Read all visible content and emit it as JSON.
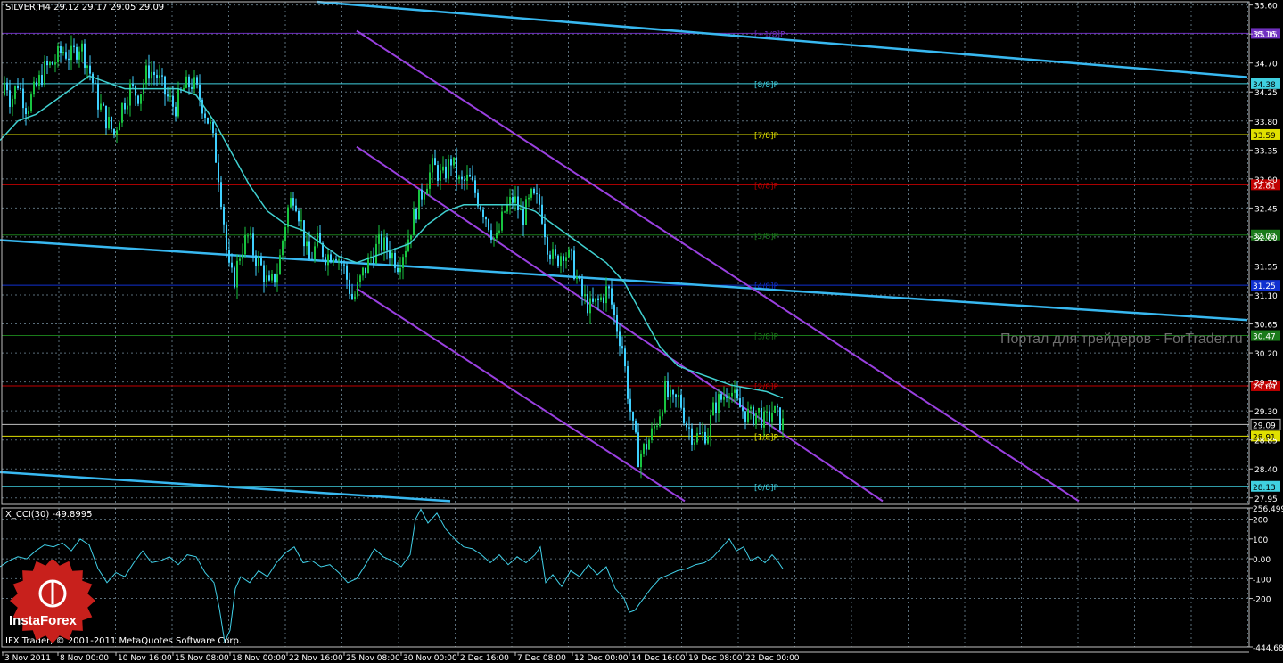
{
  "window": {
    "symbol_header": "SILVER,H4  29.12 29.17 29.05 29.09",
    "indicator_header": "X_CCI(30) -49.8995",
    "copyright": "IFX Trader, © 2001-2011 MetaQuotes Software Corp.",
    "watermark": "Портал для трейдеров - ForTrader.ru",
    "logo_text": "InstaForex"
  },
  "colors": {
    "background": "#000000",
    "grid": "#5a6e7a",
    "frame": "#c0c0c0",
    "bull_candle": "#18c440",
    "bear_candle": "#3fd0ff",
    "ma_line": "#40d0d0",
    "trend_line": "#38b8f0",
    "channel_line": "#9a40e0",
    "cci_line": "#40d0e8",
    "logo_red": "#c8201c"
  },
  "chart_data": {
    "type": "candlestick",
    "price_axis": {
      "ticks": [
        "35.60",
        "35.15",
        "34.70",
        "34.25",
        "33.80",
        "33.35",
        "32.90",
        "32.45",
        "32.00",
        "31.55",
        "31.10",
        "30.65",
        "30.20",
        "29.75",
        "29.30",
        "28.85",
        "28.40",
        "27.95"
      ],
      "range": [
        27.85,
        35.65
      ]
    },
    "time_axis": {
      "labels": [
        "3 Nov 2011",
        "8 Nov 00:00",
        "10 Nov 16:00",
        "15 Nov 08:00",
        "18 Nov 00:00",
        "22 Nov 16:00",
        "25 Nov 08:00",
        "30 Nov 00:00",
        "2 Dec 16:00",
        "7 Dec 08:00",
        "12 Dec 00:00",
        "14 Dec 16:00",
        "19 Dec 08:00",
        "22 Dec 00:00"
      ]
    },
    "murrey_levels": [
      {
        "name": "[+1/8]P",
        "value": 35.16,
        "tag": "35.16",
        "color": "#7030c0"
      },
      {
        "name": "[8/8]P",
        "value": 34.38,
        "tag": "34.38",
        "color": "#40d0e0"
      },
      {
        "name": "[7/8]P",
        "value": 33.59,
        "tag": "33.59",
        "color": "#e0e000"
      },
      {
        "name": "[6/8]P",
        "value": 32.81,
        "tag": "32.81",
        "color": "#c00000"
      },
      {
        "name": "[5/8]P",
        "value": 32.03,
        "tag": "32.03",
        "color": "#1a7a1a"
      },
      {
        "name": "[4/8]P",
        "value": 31.25,
        "tag": "31.25",
        "color": "#1030d0"
      },
      {
        "name": "[3/8]P",
        "value": 30.47,
        "tag": "30.47",
        "color": "#1a7a1a"
      },
      {
        "name": "[2/8]P",
        "value": 29.69,
        "tag": "29.69",
        "color": "#c00000"
      },
      {
        "name": "[1/8]P",
        "value": 28.91,
        "tag": "28.91",
        "color": "#e0e000"
      },
      {
        "name": "[0/8]P",
        "value": 28.13,
        "tag": "28.13",
        "color": "#40d0e0"
      }
    ],
    "current_price": {
      "value": 29.09,
      "tag": "29.09"
    },
    "ohlc_path": [
      [
        0,
        33.9
      ],
      [
        6,
        34.5
      ],
      [
        12,
        34.1
      ],
      [
        20,
        34.4
      ],
      [
        30,
        34.0
      ],
      [
        40,
        34.3
      ],
      [
        50,
        34.6
      ],
      [
        60,
        34.7
      ],
      [
        70,
        34.9
      ],
      [
        80,
        34.8
      ],
      [
        90,
        35.0
      ],
      [
        100,
        34.6
      ],
      [
        110,
        34.1
      ],
      [
        120,
        33.8
      ],
      [
        128,
        33.6
      ],
      [
        136,
        34.0
      ],
      [
        146,
        34.3
      ],
      [
        156,
        34.2
      ],
      [
        166,
        34.6
      ],
      [
        176,
        34.5
      ],
      [
        186,
        34.2
      ],
      [
        196,
        34.0
      ],
      [
        206,
        34.3
      ],
      [
        216,
        34.4
      ],
      [
        226,
        34.1
      ],
      [
        236,
        33.7
      ],
      [
        244,
        33.1
      ],
      [
        250,
        32.4
      ],
      [
        256,
        31.5
      ],
      [
        262,
        31.3
      ],
      [
        270,
        31.8
      ],
      [
        278,
        32.0
      ],
      [
        286,
        31.7
      ],
      [
        294,
        31.5
      ],
      [
        302,
        31.2
      ],
      [
        312,
        31.5
      ],
      [
        322,
        32.4
      ],
      [
        330,
        32.7
      ],
      [
        338,
        32.2
      ],
      [
        346,
        31.6
      ],
      [
        356,
        31.9
      ],
      [
        366,
        31.7
      ],
      [
        376,
        31.8
      ],
      [
        386,
        31.5
      ],
      [
        396,
        31.0
      ],
      [
        406,
        31.4
      ],
      [
        416,
        31.7
      ],
      [
        426,
        31.9
      ],
      [
        436,
        31.8
      ],
      [
        446,
        31.6
      ],
      [
        456,
        31.9
      ],
      [
        466,
        32.4
      ],
      [
        476,
        32.8
      ],
      [
        486,
        33.1
      ],
      [
        496,
        32.9
      ],
      [
        506,
        33.2
      ],
      [
        516,
        32.8
      ],
      [
        526,
        32.9
      ],
      [
        536,
        32.6
      ],
      [
        546,
        32.3
      ],
      [
        556,
        31.9
      ],
      [
        566,
        32.4
      ],
      [
        576,
        32.6
      ],
      [
        586,
        32.3
      ],
      [
        596,
        32.6
      ],
      [
        606,
        32.5
      ],
      [
        614,
        31.9
      ],
      [
        622,
        31.6
      ],
      [
        632,
        31.8
      ],
      [
        642,
        31.6
      ],
      [
        652,
        31.1
      ],
      [
        662,
        30.9
      ],
      [
        672,
        31.0
      ],
      [
        682,
        31.2
      ],
      [
        690,
        30.7
      ],
      [
        698,
        30.3
      ],
      [
        704,
        29.6
      ],
      [
        710,
        29.0
      ],
      [
        716,
        28.6
      ],
      [
        722,
        28.7
      ],
      [
        730,
        28.9
      ],
      [
        738,
        29.2
      ],
      [
        746,
        29.6
      ],
      [
        754,
        29.4
      ],
      [
        762,
        29.5
      ],
      [
        770,
        29.1
      ],
      [
        778,
        28.9
      ],
      [
        786,
        28.9
      ],
      [
        794,
        29.0
      ],
      [
        802,
        29.4
      ],
      [
        810,
        29.5
      ],
      [
        818,
        29.7
      ],
      [
        826,
        29.4
      ],
      [
        834,
        29.3
      ],
      [
        842,
        29.2
      ],
      [
        850,
        29.3
      ],
      [
        858,
        29.1
      ],
      [
        866,
        29.3
      ],
      [
        872,
        29.2
      ],
      [
        878,
        29.09
      ]
    ],
    "ma_path": [
      [
        0,
        33.5
      ],
      [
        20,
        33.8
      ],
      [
        40,
        33.9
      ],
      [
        60,
        34.1
      ],
      [
        80,
        34.3
      ],
      [
        100,
        34.5
      ],
      [
        120,
        34.4
      ],
      [
        140,
        34.3
      ],
      [
        160,
        34.3
      ],
      [
        180,
        34.3
      ],
      [
        200,
        34.3
      ],
      [
        220,
        34.2
      ],
      [
        240,
        33.8
      ],
      [
        260,
        33.3
      ],
      [
        280,
        32.8
      ],
      [
        300,
        32.4
      ],
      [
        320,
        32.2
      ],
      [
        340,
        32.1
      ],
      [
        360,
        31.9
      ],
      [
        380,
        31.7
      ],
      [
        400,
        31.6
      ],
      [
        420,
        31.7
      ],
      [
        440,
        31.8
      ],
      [
        460,
        31.9
      ],
      [
        480,
        32.2
      ],
      [
        500,
        32.4
      ],
      [
        520,
        32.5
      ],
      [
        540,
        32.5
      ],
      [
        560,
        32.5
      ],
      [
        580,
        32.5
      ],
      [
        600,
        32.4
      ],
      [
        620,
        32.2
      ],
      [
        640,
        32.0
      ],
      [
        660,
        31.8
      ],
      [
        680,
        31.6
      ],
      [
        700,
        31.3
      ],
      [
        720,
        30.8
      ],
      [
        740,
        30.3
      ],
      [
        760,
        30.0
      ],
      [
        780,
        29.9
      ],
      [
        800,
        29.8
      ],
      [
        820,
        29.7
      ],
      [
        840,
        29.65
      ],
      [
        860,
        29.6
      ],
      [
        878,
        29.5
      ]
    ],
    "trend_lines": [
      {
        "p1": [
          355,
          35.65
        ],
        "p2": [
          1399,
          34.48
        ]
      },
      {
        "p1": [
          0,
          31.95
        ],
        "p2": [
          1399,
          30.71
        ]
      },
      {
        "p1": [
          0,
          28.35
        ],
        "p2": [
          505,
          27.9
        ]
      }
    ],
    "channel_lines": [
      {
        "p1": [
          400,
          35.2
        ],
        "p2": [
          1210,
          27.9
        ]
      },
      {
        "p1": [
          400,
          33.4
        ],
        "p2": [
          990,
          27.9
        ]
      },
      {
        "p1": [
          400,
          31.2
        ],
        "p2": [
          768,
          27.9
        ]
      }
    ],
    "cci": {
      "name": "X_CCI(30)",
      "last": -49.8995,
      "ticks": [
        "256.499",
        "200",
        "100",
        "0.00",
        "-100",
        "-200",
        "-444.688"
      ],
      "range": [
        -444.688,
        256.499
      ],
      "path": [
        [
          0,
          -40
        ],
        [
          10,
          -10
        ],
        [
          20,
          10
        ],
        [
          30,
          0
        ],
        [
          40,
          40
        ],
        [
          50,
          70
        ],
        [
          60,
          60
        ],
        [
          70,
          80
        ],
        [
          80,
          40
        ],
        [
          90,
          100
        ],
        [
          100,
          70
        ],
        [
          110,
          -50
        ],
        [
          120,
          -120
        ],
        [
          130,
          -70
        ],
        [
          140,
          -90
        ],
        [
          150,
          -20
        ],
        [
          160,
          40
        ],
        [
          170,
          -20
        ],
        [
          180,
          -10
        ],
        [
          190,
          10
        ],
        [
          200,
          -30
        ],
        [
          210,
          20
        ],
        [
          220,
          10
        ],
        [
          230,
          -70
        ],
        [
          240,
          -120
        ],
        [
          246,
          -250
        ],
        [
          252,
          -420
        ],
        [
          258,
          -360
        ],
        [
          264,
          -150
        ],
        [
          270,
          -90
        ],
        [
          280,
          -120
        ],
        [
          290,
          -60
        ],
        [
          300,
          -90
        ],
        [
          310,
          -20
        ],
        [
          320,
          30
        ],
        [
          330,
          60
        ],
        [
          340,
          -20
        ],
        [
          350,
          -10
        ],
        [
          360,
          -40
        ],
        [
          370,
          -30
        ],
        [
          380,
          -70
        ],
        [
          390,
          -120
        ],
        [
          400,
          -100
        ],
        [
          410,
          -30
        ],
        [
          420,
          50
        ],
        [
          430,
          10
        ],
        [
          440,
          -10
        ],
        [
          450,
          -40
        ],
        [
          460,
          20
        ],
        [
          466,
          200
        ],
        [
          472,
          250
        ],
        [
          480,
          180
        ],
        [
          490,
          230
        ],
        [
          500,
          150
        ],
        [
          510,
          100
        ],
        [
          520,
          60
        ],
        [
          530,
          50
        ],
        [
          540,
          20
        ],
        [
          550,
          -20
        ],
        [
          560,
          20
        ],
        [
          570,
          -30
        ],
        [
          580,
          10
        ],
        [
          590,
          -20
        ],
        [
          600,
          20
        ],
        [
          606,
          60
        ],
        [
          612,
          -120
        ],
        [
          620,
          -80
        ],
        [
          630,
          -140
        ],
        [
          640,
          -60
        ],
        [
          650,
          -90
        ],
        [
          660,
          -30
        ],
        [
          670,
          -80
        ],
        [
          680,
          -40
        ],
        [
          690,
          -150
        ],
        [
          700,
          -200
        ],
        [
          706,
          -270
        ],
        [
          712,
          -260
        ],
        [
          720,
          -210
        ],
        [
          730,
          -150
        ],
        [
          740,
          -100
        ],
        [
          750,
          -80
        ],
        [
          760,
          -60
        ],
        [
          770,
          -50
        ],
        [
          780,
          -30
        ],
        [
          790,
          -20
        ],
        [
          800,
          10
        ],
        [
          810,
          60
        ],
        [
          818,
          100
        ],
        [
          826,
          40
        ],
        [
          834,
          60
        ],
        [
          842,
          -10
        ],
        [
          850,
          10
        ],
        [
          858,
          -20
        ],
        [
          866,
          20
        ],
        [
          872,
          -10
        ],
        [
          878,
          -49.9
        ]
      ]
    }
  }
}
